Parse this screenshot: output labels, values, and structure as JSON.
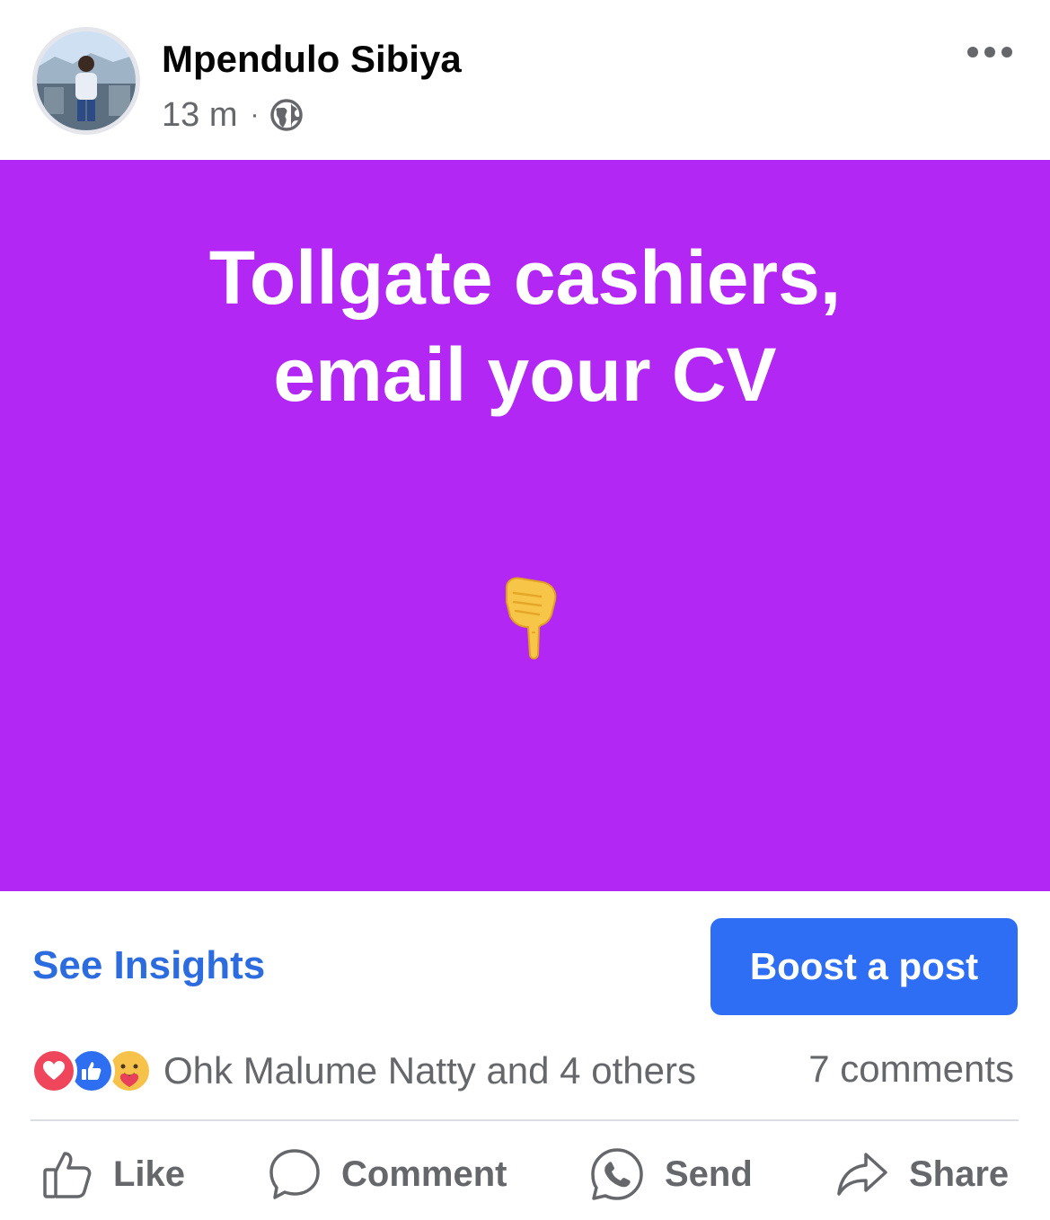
{
  "post": {
    "author": "Mpendulo Sibiya",
    "time": "13 m",
    "separator": "·",
    "audience_icon": "globe-icon",
    "text_line1": "Tollgate cashiers,",
    "text_line2": "email your CV",
    "emoji": "backhand-index-pointing-down",
    "background_color": "#b227f4"
  },
  "actions_bar": {
    "insights_label": "See Insights",
    "boost_label": "Boost a post"
  },
  "reactions": {
    "icons": [
      "love-reaction-icon",
      "like-reaction-icon",
      "care-reaction-icon"
    ],
    "summary": "Ohk Malume Natty and 4 others",
    "comments": "7 comments"
  },
  "buttons": {
    "like": "Like",
    "comment": "Comment",
    "send": "Send",
    "share": "Share"
  },
  "colors": {
    "accent": "#2d6ef5",
    "link": "#2d6cdf",
    "secondary_text": "#65676b"
  }
}
